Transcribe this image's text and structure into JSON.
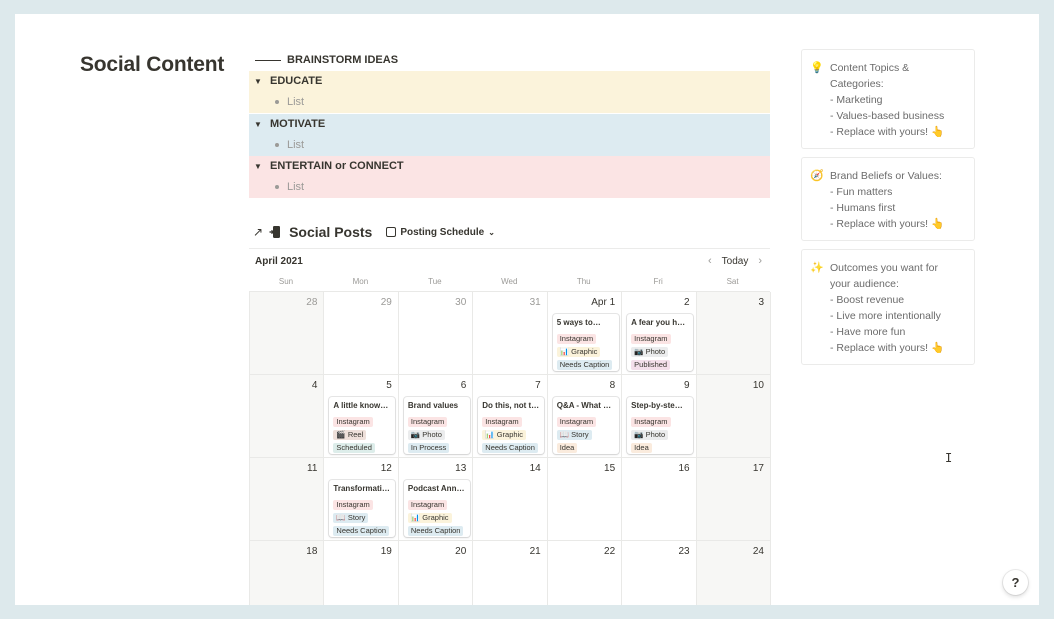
{
  "page": {
    "title": "Social Content"
  },
  "brainstorm": {
    "heading": "BRAINSTORM IDEAS",
    "sections": [
      {
        "label": "EDUCATE",
        "item": "List",
        "color": "#fbf3db"
      },
      {
        "label": "MOTIVATE",
        "item": "List",
        "color": "#ddebf1"
      },
      {
        "label": "ENTERTAIN or CONNECT",
        "item": "List",
        "color": "#fbe4e4"
      }
    ]
  },
  "posts": {
    "title": "Social Posts",
    "view": "Posting Schedule",
    "month": "April 2021",
    "today": "Today",
    "weekdays": [
      "Sun",
      "Mon",
      "Tue",
      "Wed",
      "Thu",
      "Fri",
      "Sat"
    ],
    "weeks": [
      [
        {
          "day": "28",
          "muted": true
        },
        {
          "day": "29",
          "muted": true
        },
        {
          "day": "30",
          "muted": true
        },
        {
          "day": "31",
          "muted": true
        },
        {
          "day": "Apr 1",
          "card": {
            "title": "5 ways to…",
            "tags": [
              [
                "Instagram",
                "t-insta"
              ],
              [
                "📊 Graphic",
                "t-graphic"
              ],
              [
                "Needs Caption",
                "t-caption"
              ]
            ]
          }
        },
        {
          "day": "2",
          "card": {
            "title": "A fear you h…",
            "tags": [
              [
                "Instagram",
                "t-insta"
              ],
              [
                "📷 Photo",
                "t-photo"
              ],
              [
                "Published",
                "t-published"
              ]
            ]
          }
        },
        {
          "day": "3"
        }
      ],
      [
        {
          "day": "4"
        },
        {
          "day": "5",
          "card": {
            "title": "A little know…",
            "tags": [
              [
                "Instagram",
                "t-insta"
              ],
              [
                "🎬 Reel",
                "t-reel"
              ],
              [
                "Scheduled",
                "t-scheduled"
              ]
            ]
          }
        },
        {
          "day": "6",
          "card": {
            "title": "Brand values",
            "tags": [
              [
                "Instagram",
                "t-insta"
              ],
              [
                "📷 Photo",
                "t-photo"
              ],
              [
                "In Process",
                "t-process"
              ]
            ]
          }
        },
        {
          "day": "7",
          "card": {
            "title": "Do this, not t…",
            "tags": [
              [
                "Instagram",
                "t-insta"
              ],
              [
                "📊 Graphic",
                "t-graphic"
              ],
              [
                "Needs Caption",
                "t-caption"
              ]
            ]
          }
        },
        {
          "day": "8",
          "card": {
            "title": "Q&A - What …",
            "tags": [
              [
                "Instagram",
                "t-insta"
              ],
              [
                "📖 Story",
                "t-story"
              ],
              [
                "Idea",
                "t-idea"
              ]
            ]
          }
        },
        {
          "day": "9",
          "card": {
            "title": "Step-by-ste…",
            "tags": [
              [
                "Instagram",
                "t-insta"
              ],
              [
                "📷 Photo",
                "t-photo"
              ],
              [
                "Idea",
                "t-idea"
              ]
            ]
          }
        },
        {
          "day": "10"
        }
      ],
      [
        {
          "day": "11"
        },
        {
          "day": "12",
          "card": {
            "title": "Transformati…",
            "tags": [
              [
                "Instagram",
                "t-insta"
              ],
              [
                "📖 Story",
                "t-story"
              ],
              [
                "Needs Caption",
                "t-caption"
              ]
            ]
          }
        },
        {
          "day": "13",
          "card": {
            "title": "Podcast Ann…",
            "tags": [
              [
                "Instagram",
                "t-insta"
              ],
              [
                "📊 Graphic",
                "t-graphic"
              ],
              [
                "Needs Caption",
                "t-caption"
              ]
            ]
          }
        },
        {
          "day": "14"
        },
        {
          "day": "15"
        },
        {
          "day": "16"
        },
        {
          "day": "17"
        }
      ],
      [
        {
          "day": "18"
        },
        {
          "day": "19"
        },
        {
          "day": "20"
        },
        {
          "day": "21"
        },
        {
          "day": "22"
        },
        {
          "day": "23"
        },
        {
          "day": "24"
        }
      ]
    ]
  },
  "callouts": [
    {
      "icon": "lightbulb-icon",
      "glyph": "💡",
      "lines": [
        "Content Topics &",
        "Categories:",
        "- Marketing",
        "- Values-based business",
        "- Replace with yours! 👆"
      ]
    },
    {
      "icon": "compass-icon",
      "glyph": "🧭",
      "lines": [
        "Brand Beliefs or Values:",
        "- Fun matters",
        "- Humans first",
        "- Replace with yours! 👆"
      ]
    },
    {
      "icon": "sparkles-icon",
      "glyph": "✨",
      "lines": [
        "Outcomes you want for",
        "your audience:",
        "- Boost revenue",
        "- Live more intentionally",
        "- Have more fun",
        "- Replace with yours! 👆"
      ]
    }
  ],
  "help": {
    "label": "?"
  }
}
